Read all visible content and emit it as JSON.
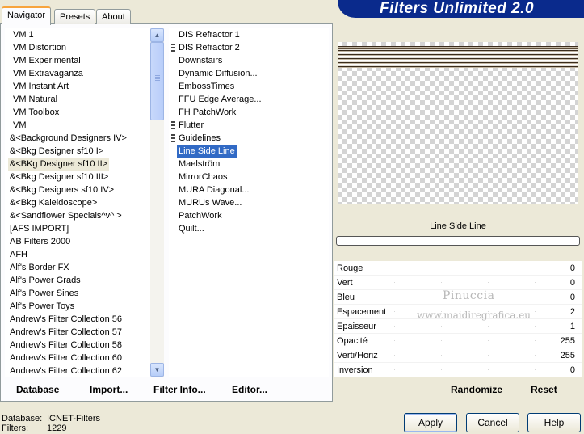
{
  "tabs": [
    "Navigator",
    "Presets",
    "About"
  ],
  "banner_title": "Filters Unlimited 2.0",
  "categories": [
    "VM 1",
    "VM Distortion",
    "VM Experimental",
    "VM Extravaganza",
    "VM Instant Art",
    "VM Natural",
    "VM Toolbox",
    "VM",
    "&<Background Designers IV>",
    "&<Bkg Designer sf10 I>",
    "&<BKg Designer sf10 II>",
    "&<Bkg Designer sf10 III>",
    "&<Bkg Designers sf10 IV>",
    "&<Bkg Kaleidoscope>",
    "&<Sandflower Specials^v^ >",
    "[AFS IMPORT]",
    "AB Filters 2000",
    "AFH",
    "Alf's Border FX",
    "Alf's Power Grads",
    "Alf's Power Sines",
    "Alf's Power Toys",
    "Andrew's Filter Collection 56",
    "Andrew's Filter Collection 57",
    "Andrew's Filter Collection 58",
    "Andrew's Filter Collection 60",
    "Andrew's Filter Collection 62"
  ],
  "selected_category": "&<BKg Designer sf10 II>",
  "filters": [
    {
      "name": "DIS Refractor 1",
      "grip": false
    },
    {
      "name": "DIS Refractor 2",
      "grip": true
    },
    {
      "name": "Downstairs",
      "grip": false
    },
    {
      "name": "Dynamic Diffusion...",
      "grip": false
    },
    {
      "name": "EmbossTimes",
      "grip": false
    },
    {
      "name": "FFU Edge Average...",
      "grip": false
    },
    {
      "name": "FH PatchWork",
      "grip": false
    },
    {
      "name": "Flutter",
      "grip": true
    },
    {
      "name": "Guidelines",
      "grip": true
    },
    {
      "name": "Line Side Line",
      "grip": false
    },
    {
      "name": "Maelström",
      "grip": false
    },
    {
      "name": "MirrorChaos",
      "grip": false
    },
    {
      "name": "MURA Diagonal...",
      "grip": false
    },
    {
      "name": "MURUs Wave...",
      "grip": false
    },
    {
      "name": "PatchWork",
      "grip": false
    },
    {
      "name": "Quilt...",
      "grip": false
    }
  ],
  "selected_filter": "Line Side Line",
  "left_buttons": {
    "database": "Database",
    "import": "Import...",
    "filter_info": "Filter Info...",
    "editor": "Editor..."
  },
  "preview": {
    "filter_title": "Line Side Line"
  },
  "params": [
    {
      "label": "Rouge",
      "value": "0"
    },
    {
      "label": "Vert",
      "value": "0"
    },
    {
      "label": "Bleu",
      "value": "0"
    },
    {
      "label": "Espacement",
      "value": "2"
    },
    {
      "label": "Epaisseur",
      "value": "1"
    },
    {
      "label": "Opacité",
      "value": "255"
    },
    {
      "label": "Verti/Horiz",
      "value": "255"
    },
    {
      "label": "Inversion",
      "value": "0"
    }
  ],
  "watermark": {
    "line1": "Pinuccia",
    "line2": "www.maidiregrafica.eu"
  },
  "right_buttons": {
    "randomize": "Randomize",
    "reset": "Reset"
  },
  "status": {
    "database_label": "Database:",
    "database_value": "ICNET-Filters",
    "filters_label": "Filters:",
    "filters_value": "1229"
  },
  "dialog_buttons": {
    "apply": "Apply",
    "cancel": "Cancel",
    "help": "Help"
  }
}
